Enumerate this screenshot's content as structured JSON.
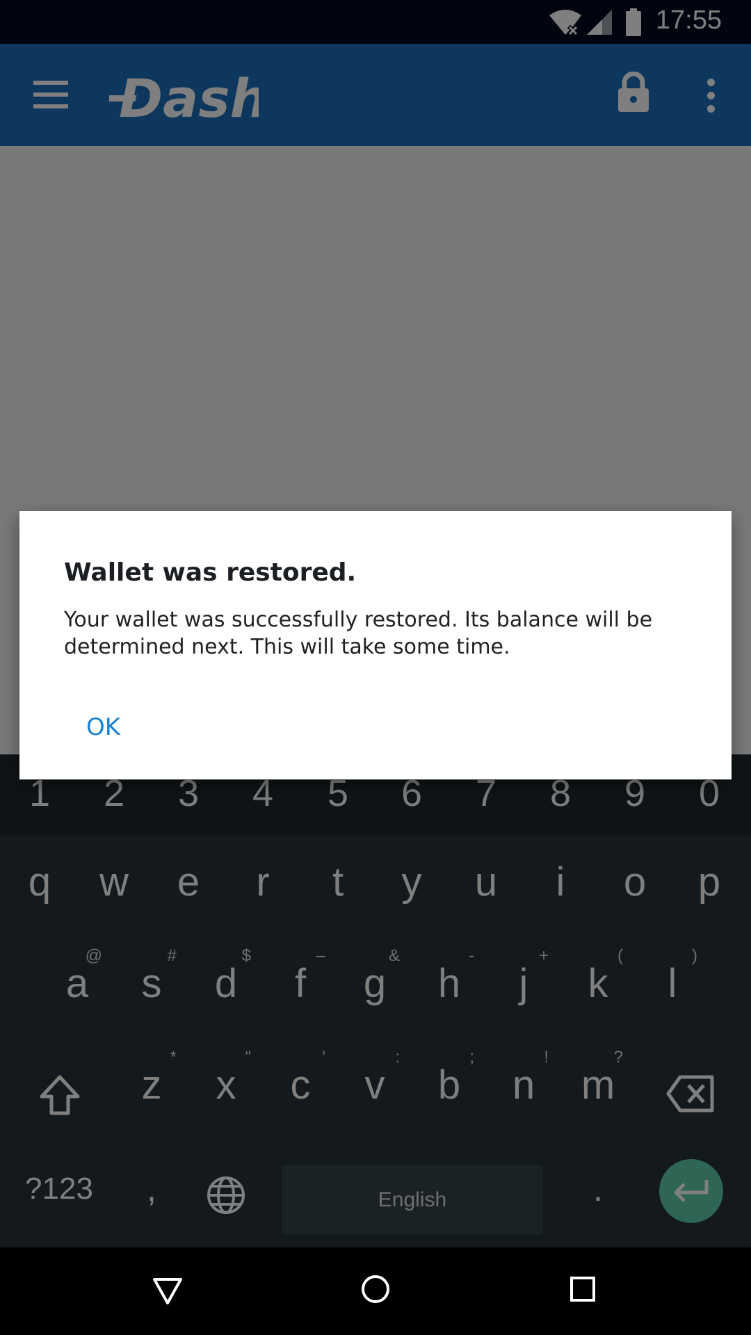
{
  "status_bar": {
    "time": "17:55",
    "icons": [
      "wifi-off-icon",
      "cellular-signal-icon",
      "battery-icon"
    ]
  },
  "app_bar": {
    "logo_text": "Dash",
    "icons": [
      "menu-icon",
      "lock-icon",
      "more-vert-icon"
    ],
    "color": "#1a6fb8"
  },
  "dialog": {
    "title": "Wallet was restored.",
    "message": "Your wallet was successfully restored. Its balance will be determined next. This will take some time.",
    "ok_label": "OK",
    "accent": "#1a80d0"
  },
  "keyboard": {
    "number_row": [
      "1",
      "2",
      "3",
      "4",
      "5",
      "6",
      "7",
      "8",
      "9",
      "0"
    ],
    "row1": [
      "q",
      "w",
      "e",
      "r",
      "t",
      "y",
      "u",
      "i",
      "o",
      "p"
    ],
    "row2": [
      {
        "key": "a",
        "hint": "@"
      },
      {
        "key": "s",
        "hint": "#"
      },
      {
        "key": "d",
        "hint": "$"
      },
      {
        "key": "f",
        "hint": "–"
      },
      {
        "key": "g",
        "hint": "&"
      },
      {
        "key": "h",
        "hint": "-"
      },
      {
        "key": "j",
        "hint": "+"
      },
      {
        "key": "k",
        "hint": "("
      },
      {
        "key": "l",
        "hint": ")"
      }
    ],
    "row3": [
      {
        "key": "z",
        "hint": "*"
      },
      {
        "key": "x",
        "hint": "\""
      },
      {
        "key": "c",
        "hint": "'"
      },
      {
        "key": "v",
        "hint": ":"
      },
      {
        "key": "b",
        "hint": ";"
      },
      {
        "key": "n",
        "hint": "!"
      },
      {
        "key": "m",
        "hint": "?"
      }
    ],
    "symbols_label": "?123",
    "comma_label": ",",
    "period_label": ".",
    "space_label": "English",
    "icons": [
      "shift-icon",
      "backspace-icon",
      "globe-icon",
      "enter-icon"
    ]
  },
  "nav_bar": {
    "icons": [
      "back-icon",
      "home-icon",
      "recents-icon"
    ]
  }
}
